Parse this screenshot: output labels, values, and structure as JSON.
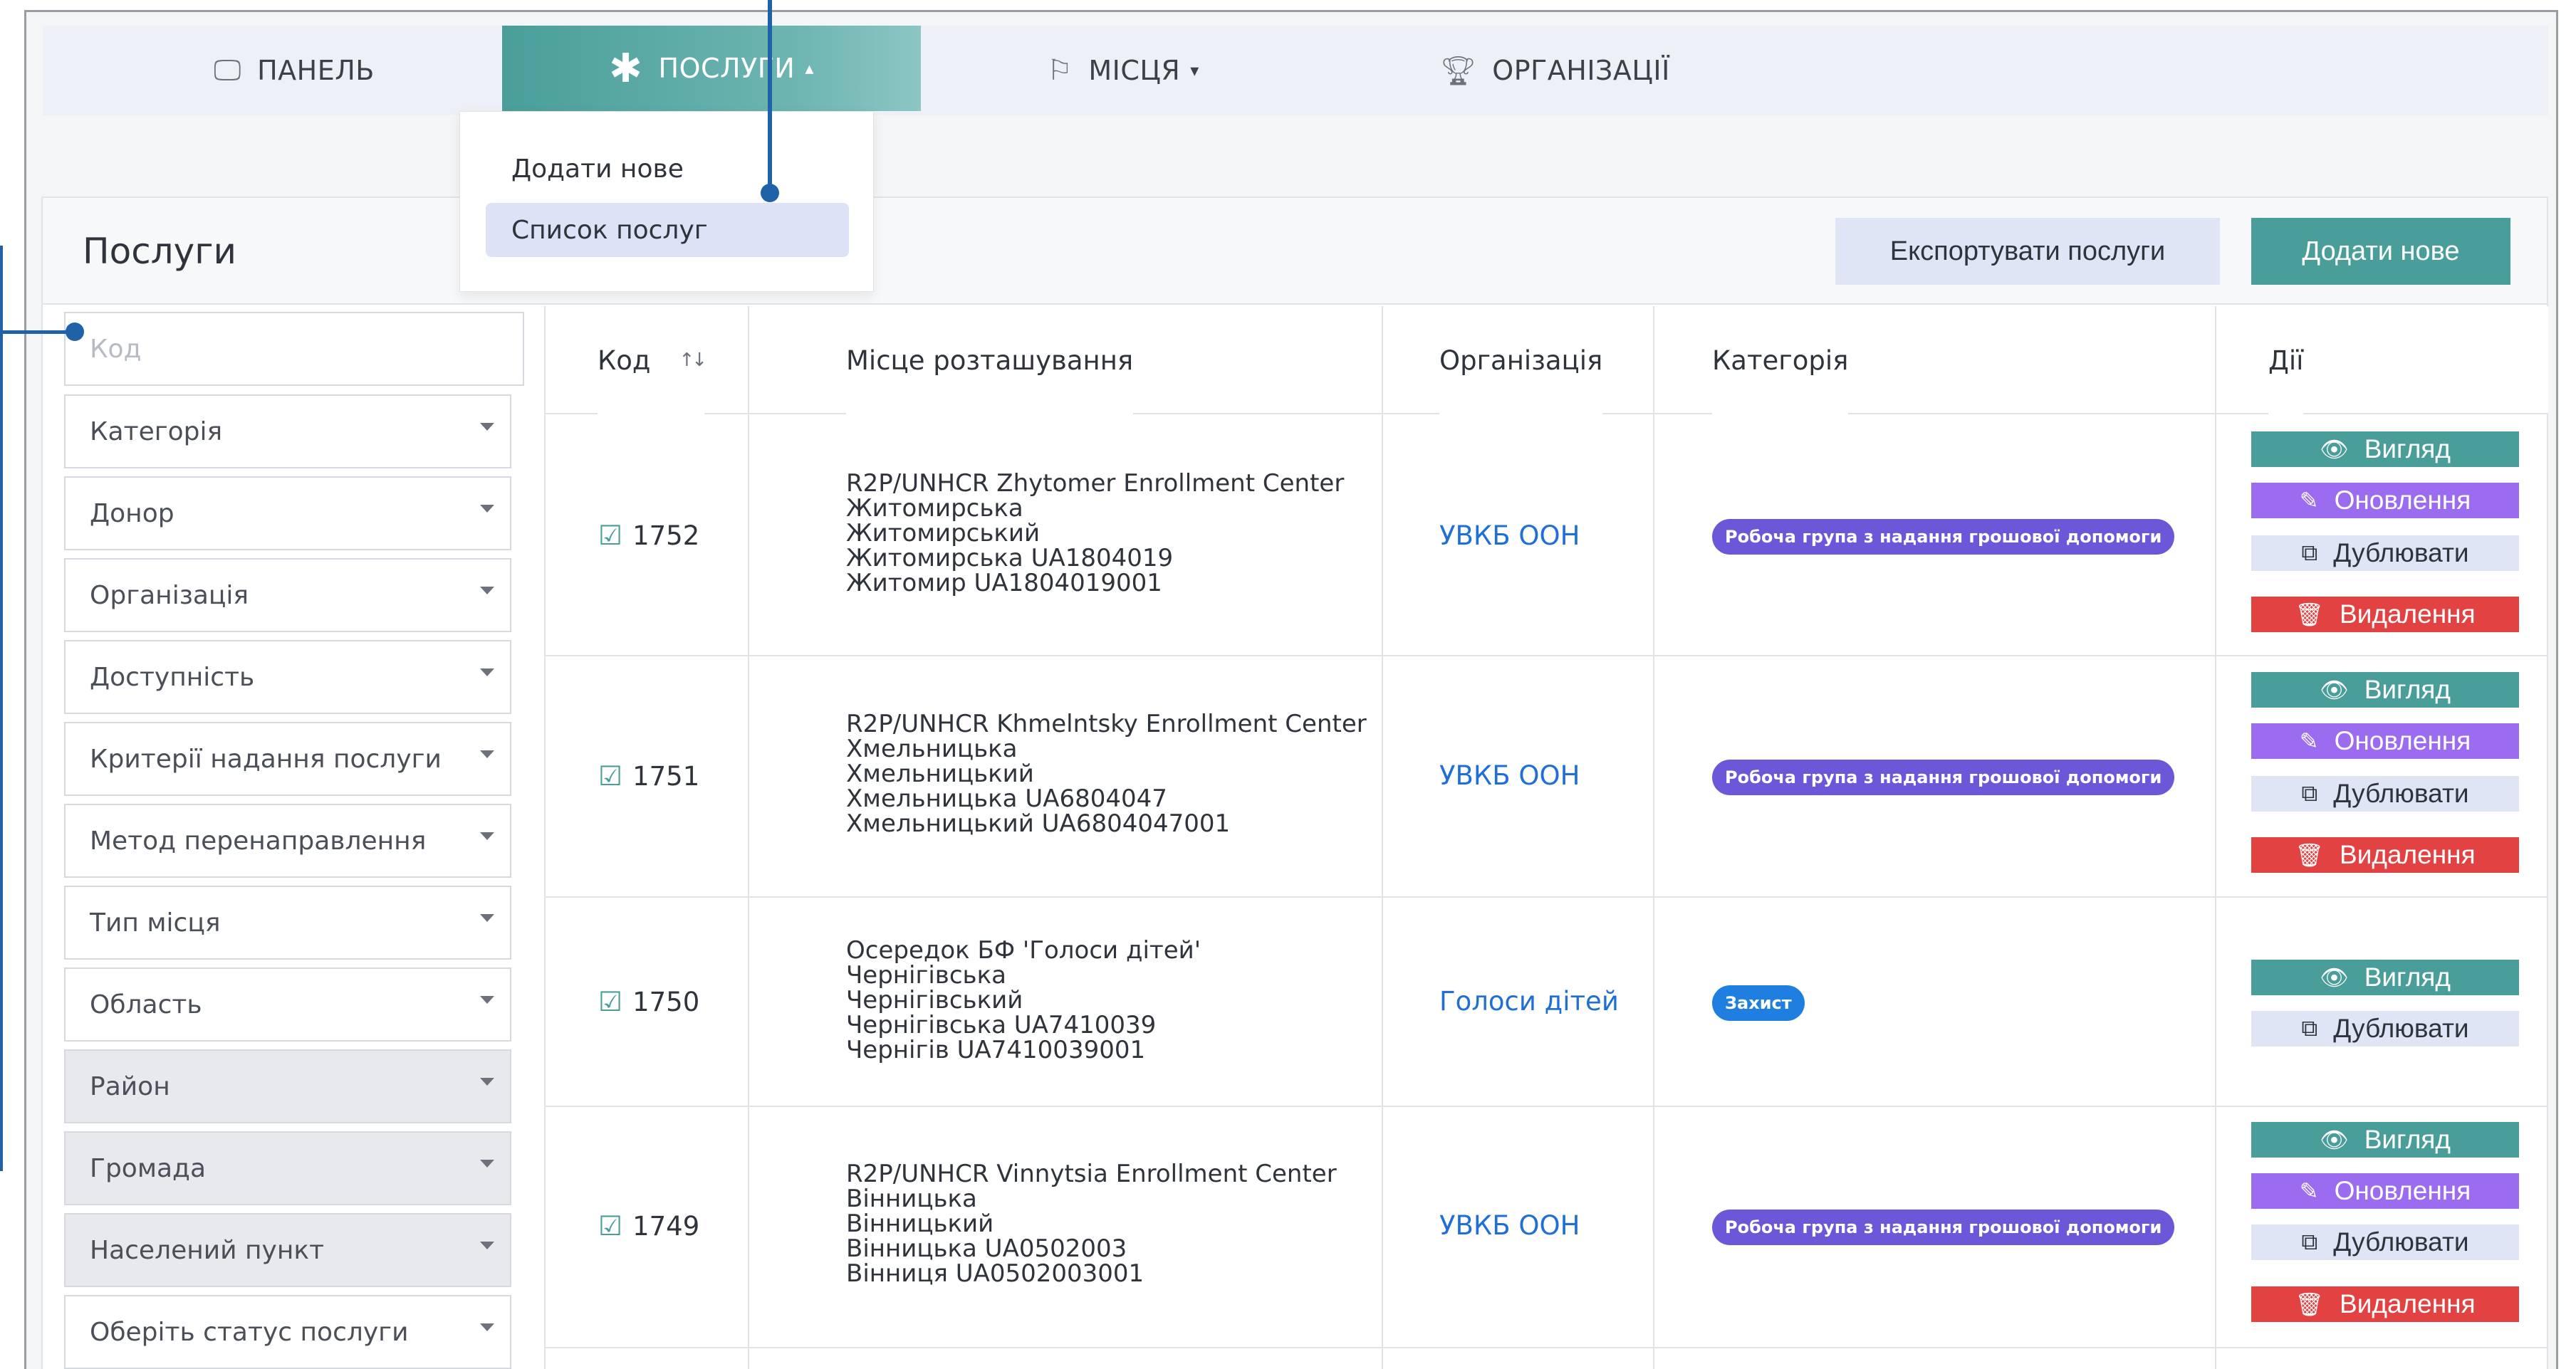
{
  "nav": {
    "panel": "ПАНЕЛЬ",
    "services": "ПОСЛУГИ",
    "places": "МІСЦЯ",
    "orgs": "ОРГАНІЗАЦІЇ",
    "panel_icon": "monitor-icon",
    "services_icon": "asterisk-icon",
    "places_icon": "flag-icon",
    "orgs_icon": "trophy-icon"
  },
  "dropdown": {
    "add_new": "Додати нове",
    "list": "Список послуг"
  },
  "header": {
    "title": "Послуги",
    "export_button": "Експортувати послуги",
    "add_button": "Додати нове"
  },
  "filters": {
    "code_placeholder": "Код",
    "selects": [
      "Категорія",
      "Донор",
      "Організація",
      "Доступність",
      "Критерії надання послуги",
      "Метод перенаправлення",
      "Тип місця",
      "Область",
      "Район",
      "Громада",
      "Населений пункт",
      "Оберіть статус послуги"
    ]
  },
  "table": {
    "headers": {
      "code": "Код",
      "location": "Місце розташування",
      "organization": "Організація",
      "category": "Категорія",
      "actions": "Дії"
    },
    "actions": {
      "view": "Вигляд",
      "update": "Оновлення",
      "duplicate": "Дублювати",
      "delete": "Видалення"
    },
    "rows": [
      {
        "code": "1752",
        "location": [
          "R2P/UNHCR Zhytomer Enrollment Center",
          "Житомирська",
          "Житомирський",
          "Житомирська UA1804019",
          "Житомир UA1804019001"
        ],
        "organization": "УВКБ ООН",
        "category": "Робоча група з надання грошової допомоги"
      },
      {
        "code": "1751",
        "location": [
          "R2P/UNHCR Khmelntsky Enrollment Center",
          "Хмельницька",
          "Хмельницький",
          "Хмельницька UA6804047",
          "Хмельницький UA6804047001"
        ],
        "organization": "УВКБ ООН",
        "category": "Робоча група з надання грошової допомоги"
      },
      {
        "code": "1750",
        "location": [
          "Осередок БФ 'Голоси дітей'",
          "Чернігівська",
          "Чернігівський",
          "Чернігівська UA7410039",
          "Чернігів UA7410039001"
        ],
        "organization": "Голоси дітей",
        "category": "Захист"
      },
      {
        "code": "1749",
        "location": [
          "R2P/UNHCR Vinnytsia Enrollment Center",
          "Вінницька",
          "Вінницький",
          "Вінницька UA0502003",
          "Вінниця UA0502003001"
        ],
        "organization": "УВКБ ООН",
        "category": "Робоча група з надання грошової допомоги"
      }
    ]
  }
}
